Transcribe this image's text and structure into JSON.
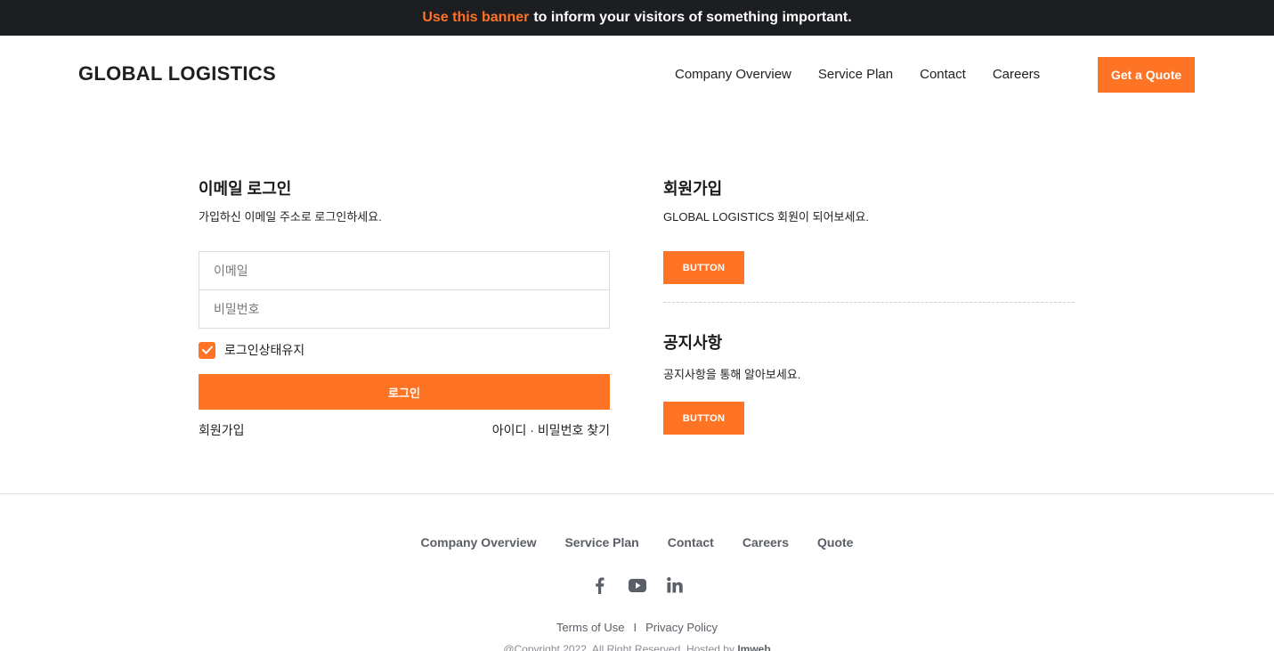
{
  "banner": {
    "accent": "Use this banner",
    "text": "to inform your visitors of something important."
  },
  "header": {
    "logo": "GLOBAL LOGISTICS",
    "nav": [
      "Company Overview",
      "Service Plan",
      "Contact",
      "Careers"
    ],
    "cta": "Get a Quote"
  },
  "login": {
    "title": "이메일 로그인",
    "subtitle": "가입하신 이메일 주소로 로그인하세요.",
    "email_placeholder": "이메일",
    "password_placeholder": "비밀번호",
    "keep_logged_in": "로그인상태유지",
    "keep_checked": true,
    "submit": "로그인",
    "signup_link": "회원가입",
    "find_link": "아이디 · 비밀번호 찾기"
  },
  "signup": {
    "title": "회원가입",
    "subtitle": "GLOBAL LOGISTICS 회원이 되어보세요.",
    "button": "BUTTON"
  },
  "notice": {
    "title": "공지사항",
    "subtitle": "공지사항을 통해 알아보세요.",
    "button": "BUTTON"
  },
  "footer": {
    "nav": [
      "Company Overview",
      "Service Plan",
      "Contact",
      "Careers",
      "Quote"
    ],
    "social": [
      "facebook-icon",
      "youtube-icon",
      "linkedin-icon"
    ],
    "terms": "Terms of Use",
    "separator": "I",
    "privacy": "Privacy Policy",
    "copyright": "@Copyright 2022. All Right Reserved. Hosted by",
    "host": "Imweb"
  },
  "colors": {
    "accent": "#ff7325",
    "banner_bg": "#1c1e22"
  }
}
